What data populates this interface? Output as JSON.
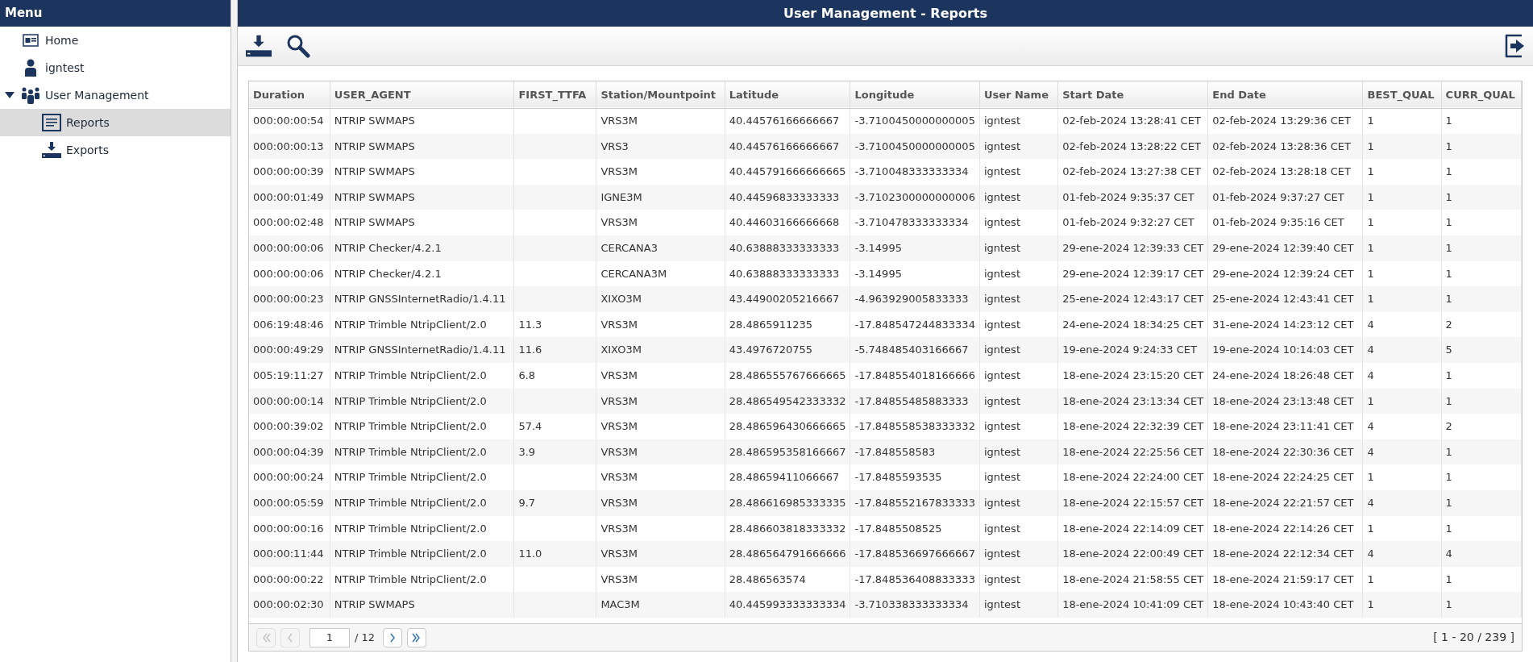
{
  "sidebar": {
    "title": "Menu",
    "items": [
      {
        "label": "Home",
        "kind": "home",
        "selected": false
      },
      {
        "label": "igntest",
        "kind": "user",
        "selected": false
      },
      {
        "label": "User Management",
        "kind": "group",
        "selected": false,
        "expanded": true,
        "children": [
          {
            "label": "Reports",
            "kind": "report",
            "selected": true
          },
          {
            "label": "Exports",
            "kind": "export",
            "selected": false
          }
        ]
      }
    ]
  },
  "header": {
    "title": "User Management - Reports"
  },
  "table": {
    "columns": [
      "Duration",
      "USER_AGENT",
      "FIRST_TTFA",
      "Station/Mountpoint",
      "Latitude",
      "Longitude",
      "User Name",
      "Start Date",
      "End Date",
      "BEST_QUAL",
      "CURR_QUAL"
    ],
    "rows": [
      [
        "000:00:00:54",
        "NTRIP SWMAPS",
        "",
        "VRS3M",
        "40.44576166666667",
        "-3.7100450000000005",
        "igntest",
        "02-feb-2024 13:28:41 CET",
        "02-feb-2024 13:29:36 CET",
        "1",
        "1"
      ],
      [
        "000:00:00:13",
        "NTRIP SWMAPS",
        "",
        "VRS3",
        "40.44576166666667",
        "-3.7100450000000005",
        "igntest",
        "02-feb-2024 13:28:22 CET",
        "02-feb-2024 13:28:36 CET",
        "1",
        "1"
      ],
      [
        "000:00:00:39",
        "NTRIP SWMAPS",
        "",
        "VRS3M",
        "40.445791666666665",
        "-3.710048333333334",
        "igntest",
        "02-feb-2024 13:27:38 CET",
        "02-feb-2024 13:28:18 CET",
        "1",
        "1"
      ],
      [
        "000:00:01:49",
        "NTRIP SWMAPS",
        "",
        "IGNE3M",
        "40.44596833333333",
        "-3.7102300000000006",
        "igntest",
        "01-feb-2024 9:35:37 CET",
        "01-feb-2024 9:37:27 CET",
        "1",
        "1"
      ],
      [
        "000:00:02:48",
        "NTRIP SWMAPS",
        "",
        "VRS3M",
        "40.44603166666668",
        "-3.710478333333334",
        "igntest",
        "01-feb-2024 9:32:27 CET",
        "01-feb-2024 9:35:16 CET",
        "1",
        "1"
      ],
      [
        "000:00:00:06",
        "NTRIP Checker/4.2.1",
        "",
        "CERCANA3",
        "40.63888333333333",
        "-3.14995",
        "igntest",
        "29-ene-2024 12:39:33 CET",
        "29-ene-2024 12:39:40 CET",
        "1",
        "1"
      ],
      [
        "000:00:00:06",
        "NTRIP Checker/4.2.1",
        "",
        "CERCANA3M",
        "40.63888333333333",
        "-3.14995",
        "igntest",
        "29-ene-2024 12:39:17 CET",
        "29-ene-2024 12:39:24 CET",
        "1",
        "1"
      ],
      [
        "000:00:00:23",
        "NTRIP GNSSInternetRadio/1.4.11",
        "",
        "XIXO3M",
        "43.44900205216667",
        "-4.963929005833333",
        "igntest",
        "25-ene-2024 12:43:17 CET",
        "25-ene-2024 12:43:41 CET",
        "1",
        "1"
      ],
      [
        "006:19:48:46",
        "NTRIP Trimble NtripClient/2.0",
        "11.3",
        "VRS3M",
        "28.4865911235",
        "-17.848547244833334",
        "igntest",
        "24-ene-2024 18:34:25 CET",
        "31-ene-2024 14:23:12 CET",
        "4",
        "2"
      ],
      [
        "000:00:49:29",
        "NTRIP GNSSInternetRadio/1.4.11",
        "11.6",
        "XIXO3M",
        "43.4976720755",
        "-5.748485403166667",
        "igntest",
        "19-ene-2024 9:24:33 CET",
        "19-ene-2024 10:14:03 CET",
        "4",
        "5"
      ],
      [
        "005:19:11:27",
        "NTRIP Trimble NtripClient/2.0",
        "6.8",
        "VRS3M",
        "28.486555767666665",
        "-17.848554018166666",
        "igntest",
        "18-ene-2024 23:15:20 CET",
        "24-ene-2024 18:26:48 CET",
        "4",
        "1"
      ],
      [
        "000:00:00:14",
        "NTRIP Trimble NtripClient/2.0",
        "",
        "VRS3M",
        "28.486549542333332",
        "-17.84855485883333",
        "igntest",
        "18-ene-2024 23:13:34 CET",
        "18-ene-2024 23:13:48 CET",
        "1",
        "1"
      ],
      [
        "000:00:39:02",
        "NTRIP Trimble NtripClient/2.0",
        "57.4",
        "VRS3M",
        "28.486596430666665",
        "-17.848558538333332",
        "igntest",
        "18-ene-2024 22:32:39 CET",
        "18-ene-2024 23:11:41 CET",
        "4",
        "2"
      ],
      [
        "000:00:04:39",
        "NTRIP Trimble NtripClient/2.0",
        "3.9",
        "VRS3M",
        "28.486595358166667",
        "-17.848558583",
        "igntest",
        "18-ene-2024 22:25:56 CET",
        "18-ene-2024 22:30:36 CET",
        "4",
        "1"
      ],
      [
        "000:00:00:24",
        "NTRIP Trimble NtripClient/2.0",
        "",
        "VRS3M",
        "28.48659411066667",
        "-17.8485593535",
        "igntest",
        "18-ene-2024 22:24:00 CET",
        "18-ene-2024 22:24:25 CET",
        "1",
        "1"
      ],
      [
        "000:00:05:59",
        "NTRIP Trimble NtripClient/2.0",
        "9.7",
        "VRS3M",
        "28.486616985333335",
        "-17.848552167833333",
        "igntest",
        "18-ene-2024 22:15:57 CET",
        "18-ene-2024 22:21:57 CET",
        "4",
        "1"
      ],
      [
        "000:00:00:16",
        "NTRIP Trimble NtripClient/2.0",
        "",
        "VRS3M",
        "28.486603818333332",
        "-17.8485508525",
        "igntest",
        "18-ene-2024 22:14:09 CET",
        "18-ene-2024 22:14:26 CET",
        "1",
        "1"
      ],
      [
        "000:00:11:44",
        "NTRIP Trimble NtripClient/2.0",
        "11.0",
        "VRS3M",
        "28.486564791666666",
        "-17.848536697666667",
        "igntest",
        "18-ene-2024 22:00:49 CET",
        "18-ene-2024 22:12:34 CET",
        "4",
        "4"
      ],
      [
        "000:00:00:22",
        "NTRIP Trimble NtripClient/2.0",
        "",
        "VRS3M",
        "28.486563574",
        "-17.848536408833333",
        "igntest",
        "18-ene-2024 21:58:55 CET",
        "18-ene-2024 21:59:17 CET",
        "1",
        "1"
      ],
      [
        "000:00:02:30",
        "NTRIP SWMAPS",
        "",
        "MAC3M",
        "40.445993333333334",
        "-3.710338333333334",
        "igntest",
        "18-ene-2024 10:41:09 CET",
        "18-ene-2024 10:43:40 CET",
        "1",
        "1"
      ]
    ]
  },
  "pagination": {
    "buttons": [
      {
        "kind": "first",
        "disabled": true
      },
      {
        "kind": "prev",
        "disabled": true
      }
    ],
    "page": "1",
    "total": "/ 12",
    "next_buttons": [
      {
        "kind": "next",
        "disabled": false
      },
      {
        "kind": "last",
        "disabled": false
      }
    ],
    "range": "[ 1 - 20 / 239 ]"
  }
}
